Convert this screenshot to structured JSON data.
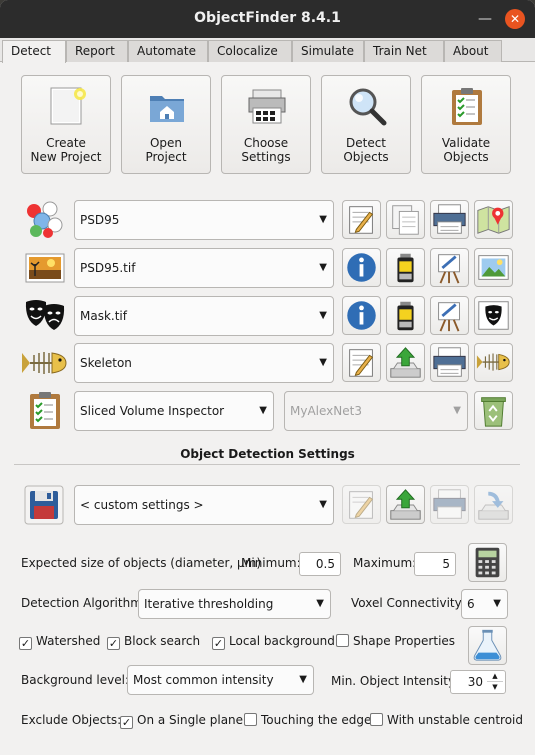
{
  "window": {
    "title": "ObjectFinder 8.4.1",
    "close_glyph": "✕",
    "minimize_glyph": "—"
  },
  "tabs": [
    "Detect",
    "Report",
    "Automate",
    "Colocalize",
    "Simulate",
    "Train Net",
    "About"
  ],
  "active_tab": "Detect",
  "toolbar": [
    {
      "label": "Create\nNew Project",
      "icon": "new-project-icon"
    },
    {
      "label": "Open\nProject",
      "icon": "open-folder-icon"
    },
    {
      "label": "Choose\nSettings",
      "icon": "settings-printer-icon"
    },
    {
      "label": "Detect\nObjects",
      "icon": "magnifier-icon"
    },
    {
      "label": "Validate\nObjects",
      "icon": "clipboard-check-icon"
    }
  ],
  "rows": {
    "objects": {
      "value": "PSD95",
      "icon": "molecule-icon"
    },
    "image": {
      "value": "PSD95.tif",
      "icon": "landscape-image-icon"
    },
    "mask": {
      "value": "Mask.tif",
      "icon": "theater-masks-icon"
    },
    "skeleton": {
      "value": "Skeleton",
      "icon": "fish-skeleton-icon"
    },
    "inspector": {
      "value": "Sliced Volume Inspector",
      "icon": "clipboard-icon",
      "net_value": "MyAlexNet3"
    }
  },
  "settings": {
    "section_title": "Object Detection Settings",
    "preset": "< custom settings >",
    "expected_size_label": "Expected size of objects (diameter, µm)",
    "min_label": "Minimum:",
    "min_value": "0.5",
    "max_label": "Maximum:",
    "max_value": "5",
    "algorithm_label": "Detection Algorithm:",
    "algorithm_value": "Iterative thresholding",
    "connectivity_label": "Voxel Connectivity:",
    "connectivity_value": "6",
    "watershed": "Watershed",
    "block_search": "Block search",
    "local_background": "Local background",
    "shape_properties": "Shape Properties",
    "background_label": "Background level:",
    "background_value": "Most common intensity",
    "min_intensity_label": "Min. Object Intensity:",
    "min_intensity_value": "30",
    "exclude_label": "Exclude Objects:",
    "single_plane": "On a Single plane",
    "touching_edge": "Touching the edge",
    "unstable_centroid": "With unstable centroid"
  },
  "checks": {
    "watershed": true,
    "block_search": true,
    "local_background": true,
    "shape_properties": false,
    "single_plane": true,
    "touching_edge": false,
    "unstable_centroid": false
  },
  "check_glyph": "✓",
  "arrow_glyph": "▼",
  "spin_up": "▲",
  "spin_down": "▼"
}
